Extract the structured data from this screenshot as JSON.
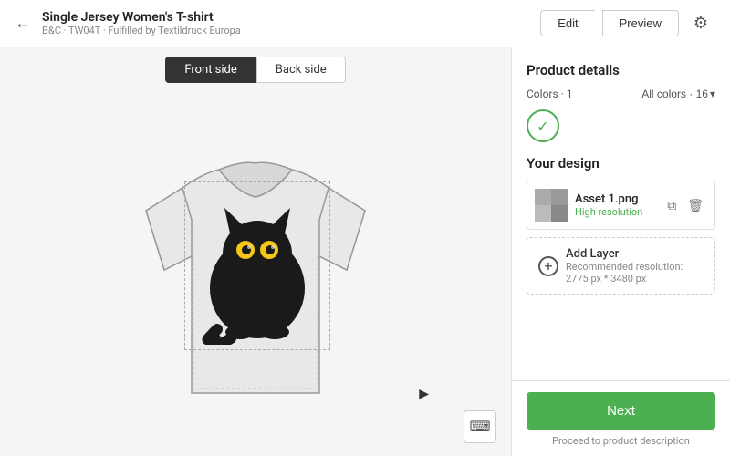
{
  "header": {
    "title": "Single Jersey Women's T-shirt",
    "subtitle": "B&C · TW04T · Fulfilled by Textildruck Europa",
    "edit_label": "Edit",
    "preview_label": "Preview"
  },
  "canvas": {
    "front_tab": "Front side",
    "back_tab": "Back side"
  },
  "product_details": {
    "section_title": "Product details",
    "colors_label": "Colors · 1",
    "all_colors_label": "All colors · 16"
  },
  "your_design": {
    "section_title": "Your design",
    "asset_name": "Asset 1.png",
    "asset_resolution": "High resolution",
    "add_layer_label": "Add Layer",
    "add_layer_resolution": "Recommended resolution: 2775 px * 3480 px"
  },
  "footer": {
    "next_label": "Next",
    "proceed_text": "Proceed to product description"
  },
  "icons": {
    "back": "←",
    "settings": "⚙",
    "copy": "⧉",
    "delete": "🗑",
    "keyboard": "⌨",
    "chevron_down": "▾",
    "plus": "+"
  }
}
